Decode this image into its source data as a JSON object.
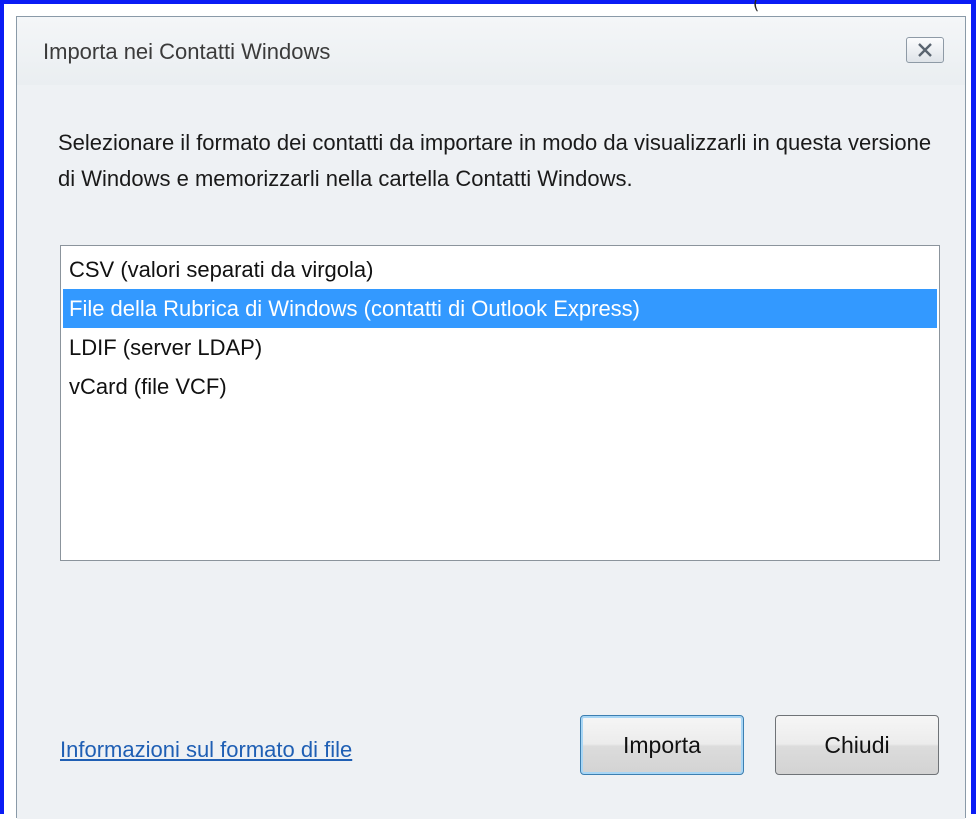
{
  "window": {
    "title": "Importa nei Contatti Windows",
    "close_icon": "close-icon"
  },
  "description": "Selezionare il formato dei contatti da importare in modo da visualizzarli in questa versione di Windows e memorizzarli nella cartella Contatti Windows.",
  "formats": {
    "items": [
      {
        "label": "CSV (valori separati da virgola)",
        "selected": false
      },
      {
        "label": "File della Rubrica di Windows (contatti di Outlook Express)",
        "selected": true
      },
      {
        "label": "LDIF (server LDAP)",
        "selected": false
      },
      {
        "label": "vCard (file VCF)",
        "selected": false
      }
    ]
  },
  "footer": {
    "help_link": "Informazioni sul formato di file",
    "import_label": "Importa",
    "close_label": "Chiudi"
  },
  "colors": {
    "outer_frame": "#0a1cf5",
    "selection": "#3399ff",
    "link": "#1f5fb4"
  }
}
